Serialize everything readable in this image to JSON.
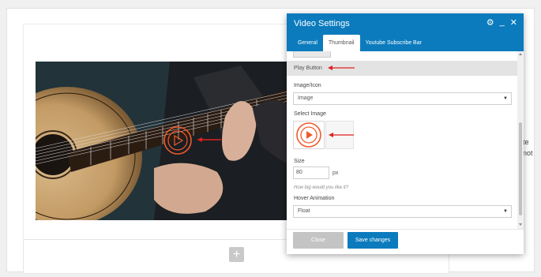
{
  "background": {
    "right_fragments": [
      "te",
      "not"
    ]
  },
  "modal": {
    "title": "Video Settings",
    "tabs": [
      {
        "label": "General",
        "active": false
      },
      {
        "label": "Thumbnail",
        "active": true
      },
      {
        "label": "Youtube Subscribe Bar",
        "active": false
      }
    ],
    "header_icons": [
      "gear-icon",
      "minimize-icon",
      "close-icon"
    ],
    "section_label": "Play Button",
    "image_icon_label": "Image/Icon",
    "image_icon_value": "Image",
    "select_image_label": "Select Image",
    "size_label": "Size",
    "size_value": "80",
    "size_unit": "px",
    "size_hint": "How big would you like it?",
    "hover_label": "Hover Animation",
    "hover_value": "Float",
    "close_label": "Close",
    "save_label": "Save changes"
  },
  "colors": {
    "header": "#0b7bbd",
    "save": "#0b7bbd",
    "close": "#c4c4c4",
    "annotation_arrow": "#e02020",
    "play_icon": "#ef5a2b"
  }
}
